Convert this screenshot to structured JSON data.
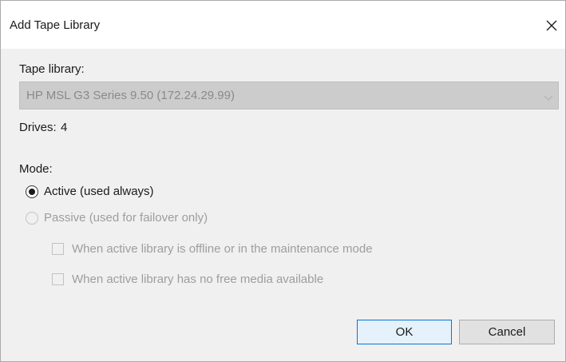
{
  "dialog": {
    "title": "Add Tape Library",
    "close_icon": "close-icon"
  },
  "tape_library": {
    "label": "Tape library:",
    "selected_value": "HP MSL G3 Series 9.50 (172.24.29.99)",
    "dropdown_icon": "chevron-down-icon"
  },
  "drives": {
    "label": "Drives:",
    "value": "4"
  },
  "mode": {
    "label": "Mode:",
    "active_label": "Active (used always)",
    "active_selected": true,
    "passive_label": "Passive (used for failover only)",
    "passive_selected": false,
    "passive_enabled": false,
    "options": [
      {
        "label": "When active library is offline or in the maintenance mode",
        "checked": false,
        "enabled": false
      },
      {
        "label": "When active library has no free media available",
        "checked": false,
        "enabled": false
      }
    ]
  },
  "buttons": {
    "ok_label": "OK",
    "cancel_label": "Cancel"
  },
  "colors": {
    "dialog_background": "#f0f0f0",
    "title_background": "#ffffff",
    "accent": "#0078d7",
    "disabled_text": "#9d9d9d"
  }
}
